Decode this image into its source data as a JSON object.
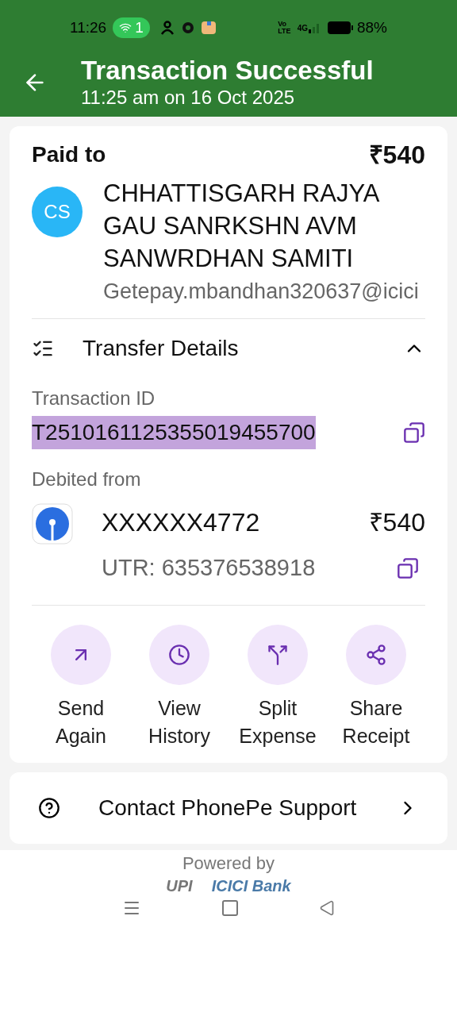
{
  "status_bar": {
    "time": "11:26",
    "hotspot_count": "1",
    "network_top": "Vo",
    "network_bottom": "LTE",
    "signal": "4G",
    "battery": "88%"
  },
  "header": {
    "title": "Transaction Successful",
    "subtitle": "11:25 am on 16 Oct 2025"
  },
  "payment": {
    "label": "Paid to",
    "initials": "CS",
    "payee": "CHHATTISGARH RAJYA GAU SANRKSHN AVM SANWRDHAN SAMITI",
    "upi_id": "Getepay.mbandhan320637@icici",
    "amount": "₹540"
  },
  "transfer": {
    "title": "Transfer Details",
    "expanded": true,
    "transaction_id_label": "Transaction ID",
    "transaction_id": "T2510161125355019455700",
    "transaction_id_selected": true,
    "debited_label": "Debited from",
    "account": "XXXXXX4772",
    "account_amount": "₹540",
    "utr": "UTR: 635376538918"
  },
  "actions": [
    {
      "kind": "send",
      "label": "Send Again"
    },
    {
      "kind": "history",
      "label": "View History"
    },
    {
      "kind": "split",
      "label": "Split Expense"
    },
    {
      "kind": "share",
      "label": "Share Receipt"
    }
  ],
  "support": {
    "label": "Contact PhonePe Support"
  },
  "footer": {
    "powered_by": "Powered by",
    "logo_1": "UPI",
    "logo_2": "ICICI Bank"
  }
}
